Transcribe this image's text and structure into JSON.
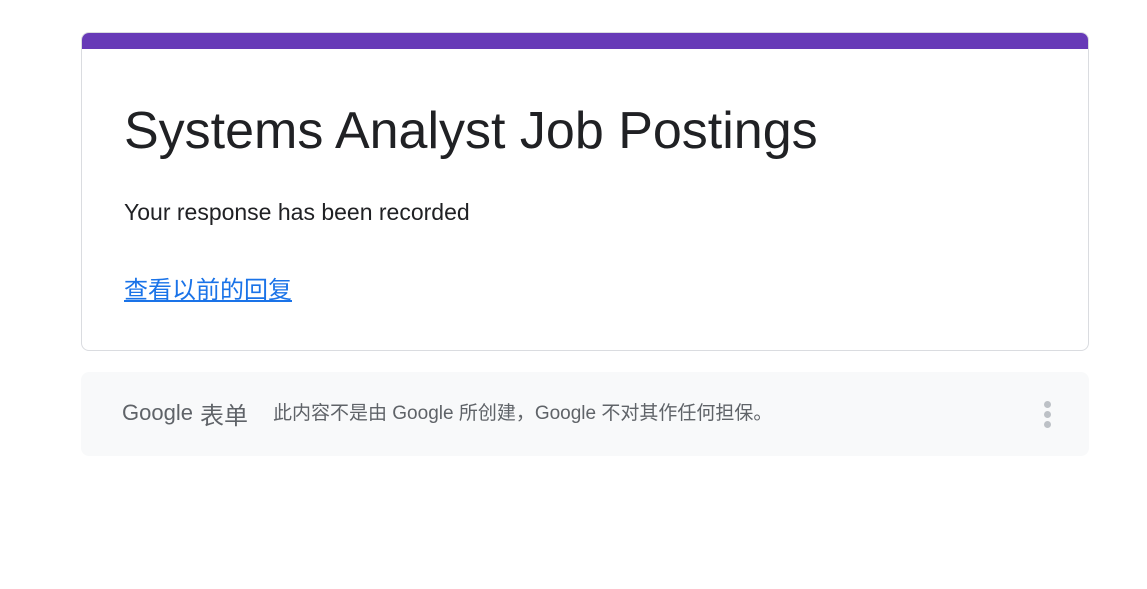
{
  "form": {
    "title": "Systems Analyst Job Postings",
    "confirmation": "Your response has been recorded",
    "view_previous_link": "查看以前的回复",
    "accent_color": "#673ab7"
  },
  "footer": {
    "brand_google": "Google",
    "brand_forms": "表单",
    "disclaimer": "此内容不是由 Google 所创建，Google 不对其作任何担保。",
    "more_icon": "more-vert-icon"
  }
}
